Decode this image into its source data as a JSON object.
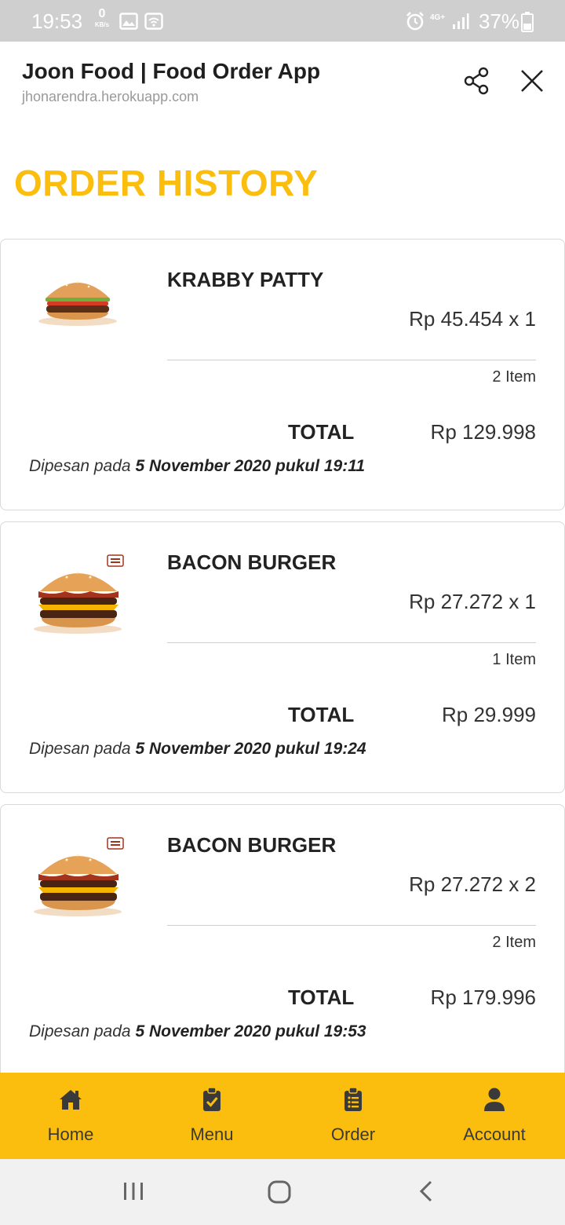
{
  "status_bar": {
    "time": "19:53",
    "net_speed_value": "0",
    "net_speed_unit": "KB/s",
    "network_type": "4G+",
    "battery": "37%",
    "icons": [
      "image-icon",
      "wifi-icon",
      "alarm-icon",
      "signal-icon",
      "battery-icon"
    ]
  },
  "browser": {
    "title": "Joon Food | Food Order App",
    "url": "jhonarendra.herokuapp.com",
    "icons": [
      "share-icon",
      "close-icon"
    ]
  },
  "page": {
    "title": "ORDER HISTORY"
  },
  "orders": [
    {
      "name": "KRABBY PATTY",
      "price_line": "Rp 45.454 x 1",
      "item_count": "2 Item",
      "total_label": "TOTAL",
      "total_value": "Rp 129.998",
      "date_prefix": "Dipesan pada ",
      "date": "5 November 2020 pukul 19:11",
      "image": "burger-image"
    },
    {
      "name": "BACON BURGER",
      "price_line": "Rp 27.272 x 1",
      "item_count": "1 Item",
      "total_label": "TOTAL",
      "total_value": "Rp 29.999",
      "date_prefix": "Dipesan pada ",
      "date": "5 November 2020 pukul 19:24",
      "image": "bacon-burger-image"
    },
    {
      "name": "BACON BURGER",
      "price_line": "Rp 27.272 x 2",
      "item_count": "2 Item",
      "total_label": "TOTAL",
      "total_value": "Rp 179.996",
      "date_prefix": "Dipesan pada ",
      "date": "5 November 2020 pukul 19:53",
      "image": "bacon-burger-image"
    }
  ],
  "bottom_nav": {
    "items": [
      {
        "label": "Home",
        "icon": "home-icon"
      },
      {
        "label": "Menu",
        "icon": "clipboard-check-icon"
      },
      {
        "label": "Order",
        "icon": "clipboard-list-icon"
      },
      {
        "label": "Account",
        "icon": "user-icon"
      }
    ]
  },
  "colors": {
    "accent": "#fbbd0e",
    "status_bar": "#cfcfcf",
    "nav_icon": "#3a3a3a"
  }
}
